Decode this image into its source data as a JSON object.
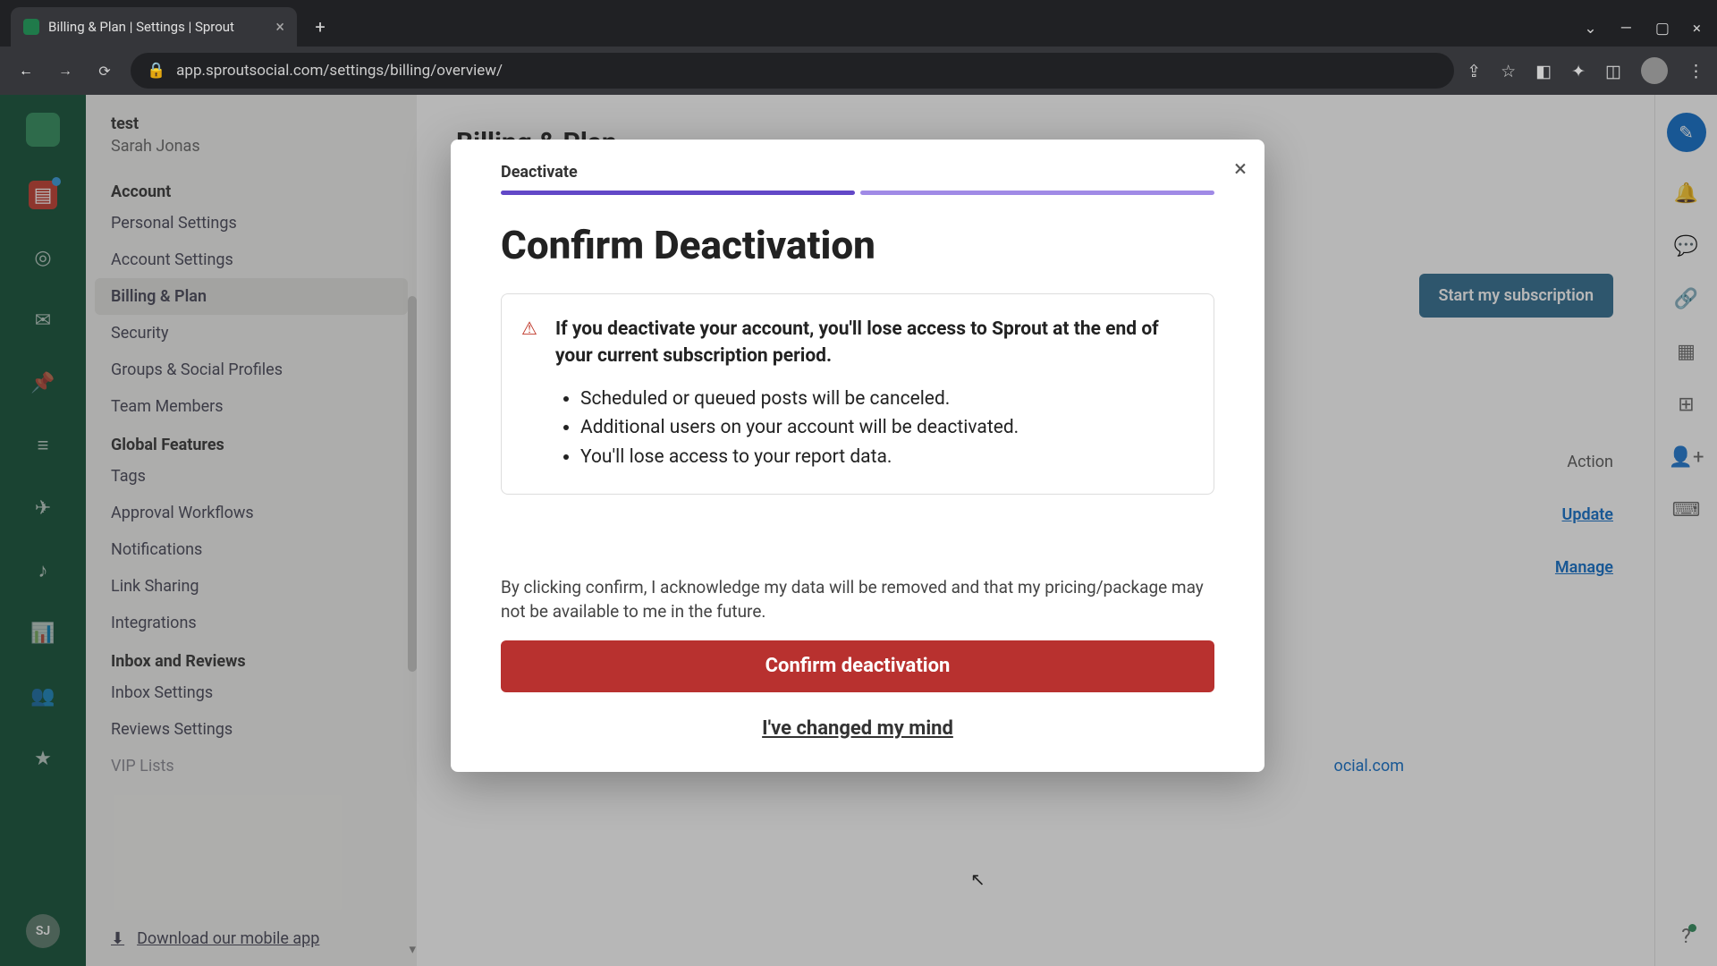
{
  "browser": {
    "tab_title": "Billing & Plan | Settings | Sprout",
    "url": "app.sproutsocial.com/settings/billing/overview/"
  },
  "user": {
    "org": "test",
    "name": "Sarah Jonas",
    "initials": "SJ"
  },
  "sidebar": {
    "section_account": "Account",
    "account_items": [
      "Personal Settings",
      "Account Settings",
      "Billing & Plan",
      "Security",
      "Groups & Social Profiles",
      "Team Members"
    ],
    "section_features": "Global Features",
    "feature_items": [
      "Tags",
      "Approval Workflows",
      "Notifications",
      "Link Sharing",
      "Integrations"
    ],
    "section_inbox": "Inbox and Reviews",
    "inbox_items": [
      "Inbox Settings",
      "Reviews Settings",
      "VIP Lists"
    ],
    "download": "Download our mobile app"
  },
  "page": {
    "title": "Billing & Plan",
    "start_sub": "Start my subscription",
    "action_header": "Action",
    "update": "Update",
    "manage": "Manage",
    "support_email_fragment": "ocial.com"
  },
  "modal": {
    "step_label": "Deactivate",
    "title": "Confirm Deactivation",
    "warning": "If you deactivate your account, you'll lose access to Sprout at the end of your current subscription period.",
    "bullets": [
      "Scheduled or queued posts will be canceled.",
      "Additional users on your account will be deactivated.",
      "You'll lose access to your report data."
    ],
    "acknowledge": "By clicking confirm, I acknowledge my data will be removed and that my pricing/package may not be available to me in the future.",
    "confirm_btn": "Confirm deactivation",
    "cancel_link": "I've changed my mind"
  }
}
